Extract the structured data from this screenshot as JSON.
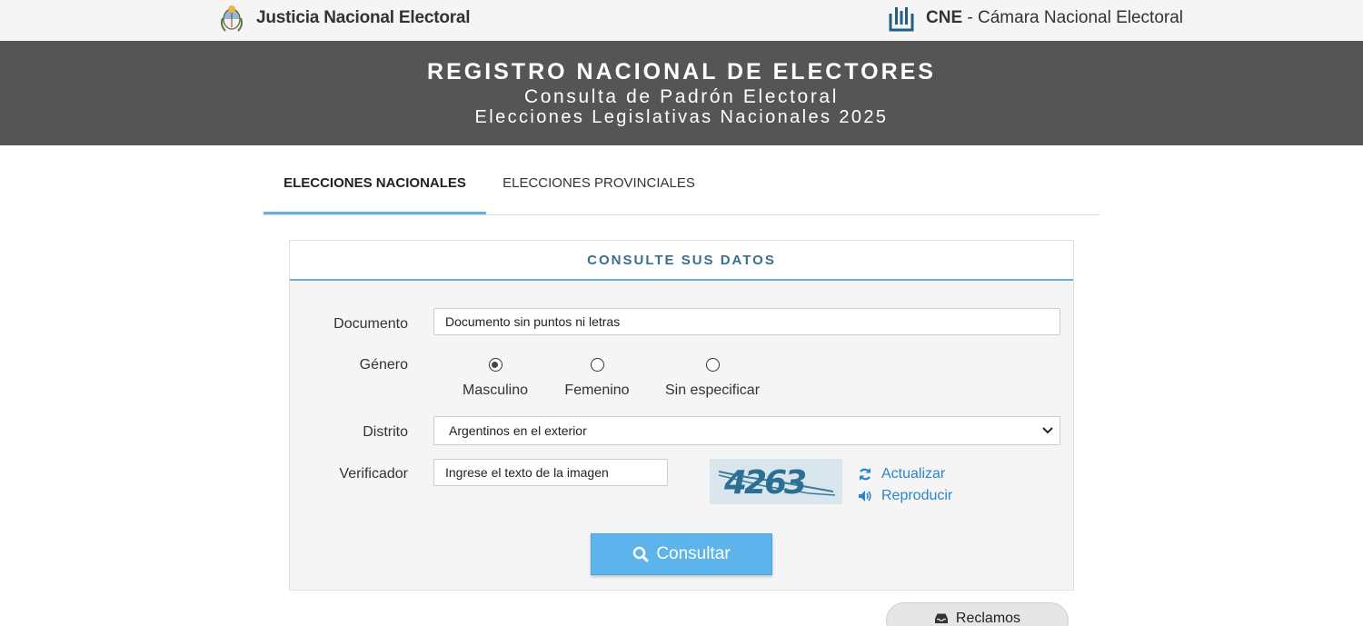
{
  "header": {
    "left_brand": "Justicia Nacional Electoral",
    "right_brand_abbr": "CNE",
    "right_brand_sep": " - ",
    "right_brand_full": "Cámara Nacional Electoral",
    "left_logo_icon": "argentina-coat-of-arms-icon",
    "right_logo_icon": "cne-building-logo-icon"
  },
  "banner": {
    "title": "REGISTRO NACIONAL DE ELECTORES",
    "subtitle": "Consulta de Padrón Electoral",
    "election": "Elecciones Legislativas Nacionales 2025"
  },
  "tabs": [
    {
      "label": "ELECCIONES NACIONALES",
      "active": true
    },
    {
      "label": "ELECCIONES PROVINCIALES",
      "active": false
    }
  ],
  "form": {
    "heading": "CONSULTE SUS DATOS",
    "documento_label": "Documento",
    "documento_placeholder": "Documento sin puntos ni letras",
    "genero_label": "Género",
    "genero_options": [
      {
        "label": "Masculino",
        "checked": true
      },
      {
        "label": "Femenino",
        "checked": false
      },
      {
        "label": "Sin especificar",
        "checked": false
      }
    ],
    "distrito_label": "Distrito",
    "distrito_selected": "Argentinos en el exterior",
    "verificador_label": "Verificador",
    "verificador_placeholder": "Ingrese el texto de la imagen",
    "captcha_text": "4263",
    "actualizar_label": "Actualizar",
    "reproducir_label": "Reproducir",
    "submit_label": "Consultar"
  },
  "reclamos_label": "Reclamos",
  "colors": {
    "accent": "#6aaedd",
    "button": "#5db4ec",
    "banner_bg": "#555555",
    "link": "#2a86c8",
    "heading": "#3a6f8f"
  }
}
